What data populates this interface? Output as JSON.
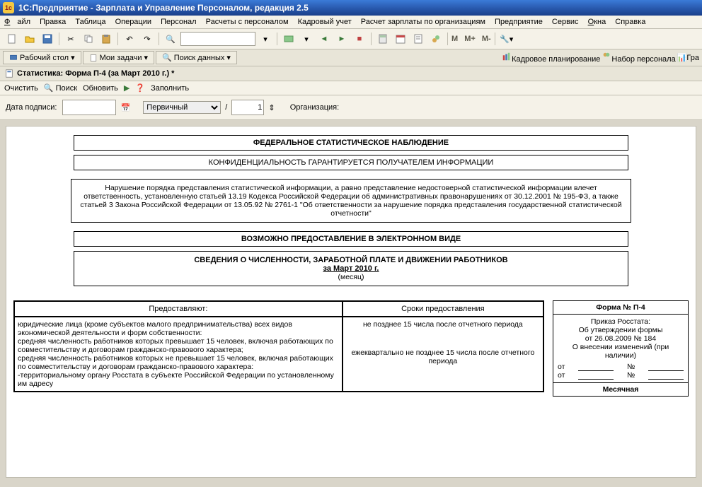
{
  "title": "1С:Предприятие - Зарплата и Управление Персоналом, редакция 2.5",
  "menu": {
    "file": "Файл",
    "edit": "Правка",
    "table": "Таблица",
    "ops": "Операции",
    "pers": "Персонал",
    "calc": "Расчеты с персоналом",
    "kadr": "Кадровый учет",
    "payroll": "Расчет зарплаты по организациям",
    "ent": "Предприятие",
    "srv": "Сервис",
    "win": "Окна",
    "help": "Справка"
  },
  "tabs": {
    "desk": "Рабочий стол",
    "my": "Мои задачи",
    "search": "Поиск данных",
    "kadrplan": "Кадровое планирование",
    "recruit": "Набор персонала",
    "gra": "Гра"
  },
  "mbtn": {
    "m": "M",
    "mp": "M+",
    "mm": "M-"
  },
  "doc": {
    "wintitle": "Статистика: Форма П-4 (за Март 2010 г.) *",
    "sub": {
      "clear": "Очистить",
      "find": "Поиск",
      "refresh": "Обновить",
      "fill": "Заполнить"
    },
    "fields": {
      "date_label": "Дата подписи:",
      "primary": "Первичный",
      "slash": "/",
      "num": "1",
      "org_label": "Организация:"
    }
  },
  "form": {
    "h1": "ФЕДЕРАЛЬНОЕ СТАТИСТИЧЕСКОЕ НАБЛЮДЕНИЕ",
    "h2": "КОНФИДЕНЦИАЛЬНОСТЬ ГАРАНТИРУЕТСЯ ПОЛУЧАТЕЛЕМ ИНФОРМАЦИИ",
    "note": "Нарушение порядка представления статистической информации, а равно представление недостоверной статистической информации влечет ответственность, установленную статьей 13.19 Кодекса Российской Федерации об административных правонарушениях от 30.12.2001 № 195-ФЗ, а также статьей 3 Закона Российской Федерации от 13.05.92 № 2761-1 \"Об ответственности за нарушение порядка представления государственной статистической отчетности\"",
    "h3": "ВОЗМОЖНО ПРЕДОСТАВЛЕНИЕ В ЭЛЕКТРОННОМ ВИДЕ",
    "title": "СВЕДЕНИЯ О ЧИСЛЕННОСТИ, ЗАРАБОТНОЙ ПЛАТЕ И ДВИЖЕНИИ РАБОТНИКОВ",
    "period": "за Март 2010 г.",
    "period_sub": "(месяц)",
    "col1": "Предоставляют:",
    "col2": "Сроки предоставления",
    "cell1": "юридические лица (кроме субъектов малого предпринимательства) всех видов экономической деятельности и форм собственности:\n  средняя численность работников которых превышает 15 человек, включая работающих по совместительству и договорам гражданско-правового характера;\n  средняя численность работников которых не превышает 15 человек, включая работающих по совместительству и договорам гражданско-правового характера:\n    -территориальному органу Росстата в субъекте Российской Федерации по установленному им адресу",
    "cell2a": "не позднее 15 числа после отчетного периода",
    "cell2b": "ежеквартально не позднее 15 числа после отчетного периода",
    "formno": "Форма № П-4",
    "order": "Приказ Росстата:\nОб утверждении формы\nот 26.08.2009 № 184\nО внесении изменений (при наличии)",
    "ot": "от",
    "no": "№",
    "monthly": "Месячная"
  }
}
